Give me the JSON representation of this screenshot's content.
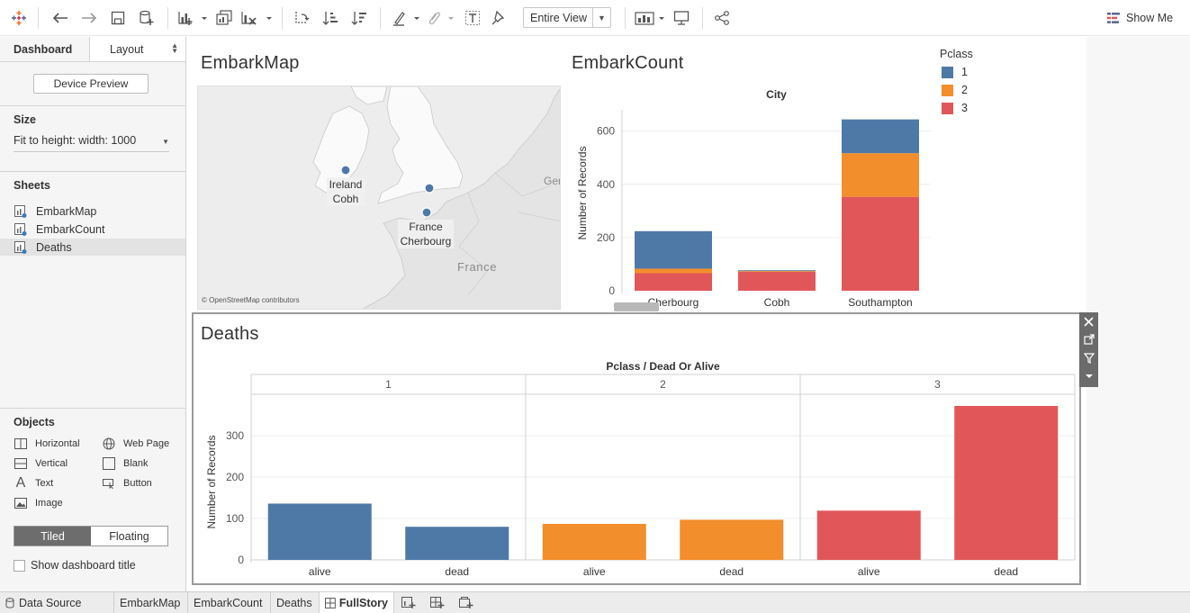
{
  "toolbar": {
    "fit_label": "Entire View",
    "show_me_label": "Show Me"
  },
  "left_pane": {
    "tabs": [
      {
        "label": "Dashboard"
      },
      {
        "label": "Layout"
      }
    ],
    "device_preview_label": "Device Preview",
    "size_heading": "Size",
    "size_value": "Fit to height: width: 1000",
    "sheets_heading": "Sheets",
    "sheets": [
      {
        "label": "EmbarkMap"
      },
      {
        "label": "EmbarkCount"
      },
      {
        "label": "Deaths"
      }
    ],
    "objects_heading": "Objects",
    "objects": [
      {
        "label": "Horizontal"
      },
      {
        "label": "Web Page"
      },
      {
        "label": "Vertical"
      },
      {
        "label": "Blank"
      },
      {
        "label": "Text"
      },
      {
        "label": "Button"
      },
      {
        "label": "Image"
      }
    ],
    "tiled_label": "Tiled",
    "floating_label": "Floating",
    "show_title_label": "Show dashboard title"
  },
  "colors": {
    "pclass1": "#4e79a7",
    "pclass2": "#f28e2b",
    "pclass3": "#e15759"
  },
  "map": {
    "title": "EmbarkMap",
    "labels": {
      "ireland": "Ireland",
      "cobh": "Cobh",
      "france_region": "France",
      "cherbourg": "Cherbourg",
      "france": "France",
      "ger": "Ger"
    },
    "attribution": "© OpenStreetMap contributors"
  },
  "legend": {
    "title": "Pclass",
    "items": [
      {
        "label": "1",
        "color": "#4e79a7"
      },
      {
        "label": "2",
        "color": "#f28e2b"
      },
      {
        "label": "3",
        "color": "#e15759"
      }
    ]
  },
  "chart_data": [
    {
      "type": "bar",
      "stacked": true,
      "title": "EmbarkCount",
      "column_header": "City",
      "ylabel": "Number of Records",
      "categories": [
        "Cherbourg",
        "Cobh",
        "Southampton"
      ],
      "series": [
        {
          "name": "1",
          "values": [
            141,
            3,
            127
          ]
        },
        {
          "name": "2",
          "values": [
            17,
            3,
            164
          ]
        },
        {
          "name": "3",
          "values": [
            66,
            71,
            353
          ]
        }
      ],
      "yticks": [
        0,
        200,
        400,
        600
      ],
      "ylim": [
        0,
        680
      ],
      "grid": true
    },
    {
      "type": "bar",
      "title": "Deaths",
      "column_header": "Pclass  /  Dead Or Alive",
      "ylabel": "Number of Records",
      "groups": [
        {
          "label": "1",
          "color": "#4e79a7",
          "bars": [
            {
              "label": "alive",
              "value": 136
            },
            {
              "label": "dead",
              "value": 80
            }
          ]
        },
        {
          "label": "2",
          "color": "#f28e2b",
          "bars": [
            {
              "label": "alive",
              "value": 87
            },
            {
              "label": "dead",
              "value": 97
            }
          ]
        },
        {
          "label": "3",
          "color": "#e15759",
          "bars": [
            {
              "label": "alive",
              "value": 119
            },
            {
              "label": "dead",
              "value": 372
            }
          ]
        }
      ],
      "yticks": [
        0,
        100,
        200,
        300
      ],
      "ylim": [
        0,
        385
      ],
      "grid": true
    }
  ],
  "bottom_tabs": [
    {
      "label": "Data Source"
    },
    {
      "label": "EmbarkMap"
    },
    {
      "label": "EmbarkCount"
    },
    {
      "label": "Deaths"
    },
    {
      "label": "FullStory"
    }
  ]
}
